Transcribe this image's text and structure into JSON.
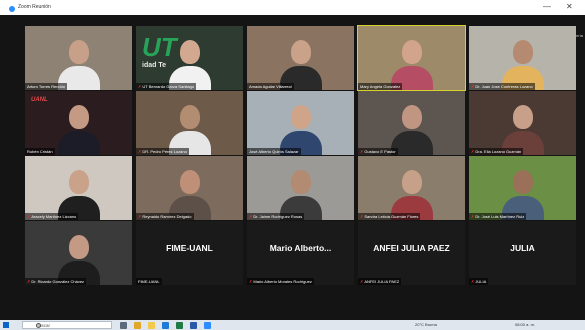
{
  "window": {
    "title": "Zoom Reunión",
    "minimize_glyph": "—",
    "close_glyph": "✕",
    "view_label": "Vista de galería"
  },
  "participants": [
    {
      "name": "Arturo Torres Rendón",
      "muted": false,
      "bg": "#8e8274",
      "skin": "#c8a08a",
      "shirt": "#e9e9e9"
    },
    {
      "name": "UT Bernardo Garza Santiago",
      "muted": true,
      "bg": "#2e3b30",
      "skin": "#d3a891",
      "shirt": "#f1f1f1",
      "logo": "UT",
      "banner": "idad Te"
    },
    {
      "name": "Amada Aguilar Villarreal",
      "muted": false,
      "bg": "#8a7361",
      "skin": "#caa189",
      "shirt": "#2a2a2a"
    },
    {
      "name": "Mary Angela Gonzalez",
      "muted": false,
      "bg": "#9c8a68",
      "skin": "#d2a48b",
      "shirt": "#b54e64",
      "active": true
    },
    {
      "name": "Dr. Juan Jose Contreras Lozano",
      "muted": true,
      "bg": "#b5b3aa",
      "skin": "#b68a70",
      "shirt": "#e3b35d"
    },
    {
      "name": "Rubén Cristán",
      "muted": false,
      "bg": "#2b1c20",
      "skin": "#c49a84",
      "shirt": "#1c1c28",
      "logo": "UANL"
    },
    {
      "name": "DR. Pedro Pérez Lozano",
      "muted": true,
      "bg": "#6e5a49",
      "skin": "#b38d72",
      "shirt": "#e6e6e6"
    },
    {
      "name": "José Alberto Quirós Salazar",
      "muted": false,
      "bg": "#a7b0b7",
      "skin": "#d0a489",
      "shirt": "#2f466e"
    },
    {
      "name": "Gustavo E Pastor",
      "muted": true,
      "bg": "#5d5550",
      "skin": "#c09683",
      "shirt": "#2a2a2a"
    },
    {
      "name": "Dra. Elia Lozano Guzmán",
      "muted": true,
      "bg": "#4a3a33",
      "skin": "#c8a08a",
      "shirt": "#6b3f3a"
    },
    {
      "name": "Aracely Martínez Lizcano",
      "muted": true,
      "bg": "#cfc8c0",
      "skin": "#caa189",
      "shirt": "#1f1f1f"
    },
    {
      "name": "Reynaldo Ramírez Delgado",
      "muted": true,
      "bg": "#7d6c5d",
      "skin": "#c08f77",
      "shirt": "#5c5048"
    },
    {
      "name": "Dr. Jaime Rodríguez Rosas",
      "muted": true,
      "bg": "#9c9a96",
      "skin": "#b38a72",
      "shirt": "#3b3b3b"
    },
    {
      "name": "Sandra Leticia Guzmán Flores",
      "muted": true,
      "bg": "#8a7d6c",
      "skin": "#c7a089",
      "shirt": "#9c3b3f"
    },
    {
      "name": "Dr. José Luis Martínez Ruiz",
      "muted": true,
      "bg": "#6a8f45",
      "skin": "#9b7058",
      "shirt": "#4a5f7a"
    },
    {
      "name": "Dr. Ricardo González Chávez",
      "muted": true,
      "bg": "#3a3a3a",
      "skin": "#c49a84",
      "shirt": "#1d1d1d"
    }
  ],
  "name_tiles": [
    {
      "display": "FIME-UANL",
      "tag": "FIME-UANL",
      "muted": false
    },
    {
      "display": "Mario Alberto...",
      "tag": "Mario Alberto Morales Rodríguez",
      "muted": true
    },
    {
      "display": "ANFEI JULIA PAEZ",
      "tag": "ANFEI JULIA PAEZ",
      "muted": true
    },
    {
      "display": "JULIA",
      "tag": "JULIA",
      "muted": true
    }
  ],
  "taskbar": {
    "search_placeholder": "Buscar",
    "icons": [
      {
        "name": "task-view-icon",
        "color": "#5a6a7a"
      },
      {
        "name": "chrome-icon",
        "color": "#e2a72a"
      },
      {
        "name": "file-explorer-icon",
        "color": "#f2c94c"
      },
      {
        "name": "edge-icon",
        "color": "#1f7ad8"
      },
      {
        "name": "excel-icon",
        "color": "#1f7a45"
      },
      {
        "name": "word-icon",
        "color": "#2b5aa8"
      },
      {
        "name": "zoom-icon",
        "color": "#2d8cff"
      }
    ],
    "weather": "20°C Bruma",
    "time": "08:00 a. m.",
    "date": "…/…/2021"
  }
}
